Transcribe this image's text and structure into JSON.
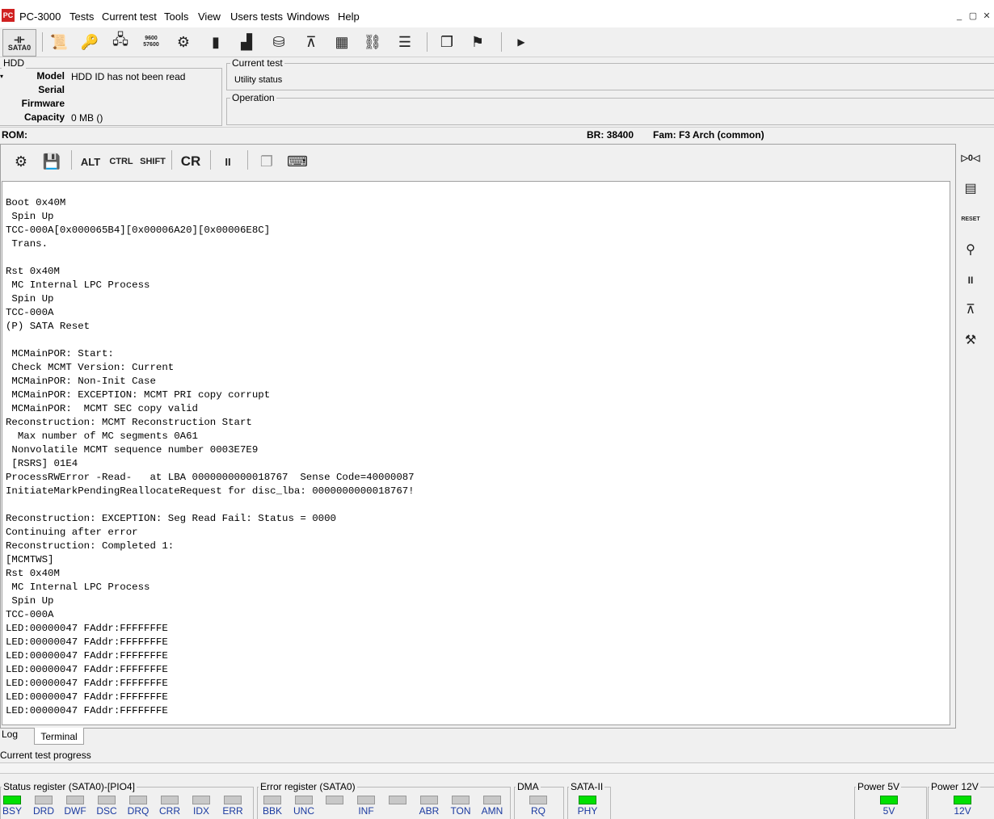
{
  "app": {
    "title": "PC-3000",
    "logo_text": "PC",
    "menu": [
      "Tests",
      "Current test",
      "Tools",
      "View",
      "Users tests",
      "Windows",
      "Help"
    ],
    "window_controls": [
      "_",
      "▢",
      "✕"
    ]
  },
  "toolbar": {
    "port_label": "SATA0",
    "buttons": [
      {
        "name": "scroll-icon",
        "glyph": "📜"
      },
      {
        "name": "key-icon",
        "glyph": "🔑"
      },
      {
        "name": "device-icon",
        "glyph": "🖧"
      },
      {
        "name": "baud-icon",
        "glyph": "9600\n57600"
      },
      {
        "name": "gear-settings-icon",
        "glyph": "⚙"
      },
      {
        "name": "chip-icon",
        "glyph": "▮"
      },
      {
        "name": "hdd-chart-icon",
        "glyph": "▟"
      },
      {
        "name": "disk-icon",
        "glyph": "⛁"
      },
      {
        "name": "heads-icon",
        "glyph": "⊼"
      },
      {
        "name": "grid-icon",
        "glyph": "▦"
      },
      {
        "name": "network-icon",
        "glyph": "⛓"
      },
      {
        "name": "list-icon",
        "glyph": "☰"
      },
      {
        "name": "copy-icon",
        "glyph": "❐"
      },
      {
        "name": "runner-icon",
        "glyph": "⚑"
      },
      {
        "name": "play-icon",
        "glyph": "▶"
      }
    ]
  },
  "hdd": {
    "group_label": "HDD",
    "fields": [
      {
        "label": "Model",
        "value": "HDD ID has not been read"
      },
      {
        "label": "Serial",
        "value": ""
      },
      {
        "label": "Firmware",
        "value": ""
      },
      {
        "label": "Capacity",
        "value": "0 MB ()"
      }
    ]
  },
  "current_test": {
    "group_label": "Current test",
    "status": "Utility status"
  },
  "operation": {
    "group_label": "Operation"
  },
  "rom_bar": {
    "rom": "ROM:",
    "br": "BR: 38400",
    "fam": "Fam: F3 Arch (common)"
  },
  "terminal_toolbar": {
    "alt": "ALT",
    "ctrl": "CTRL",
    "shift": "SHIFT",
    "cr": "CR",
    "pause": "II"
  },
  "terminal": {
    "lines": [
      "Boot 0x40M",
      " Spin Up",
      "TCC-000A[0x000065B4][0x00006A20][0x00006E8C]",
      " Trans.",
      "",
      "Rst 0x40M",
      " MC Internal LPC Process",
      " Spin Up",
      "TCC-000A",
      "(P) SATA Reset",
      "",
      " MCMainPOR: Start:",
      " Check MCMT Version: Current",
      " MCMainPOR: Non-Init Case",
      " MCMainPOR: EXCEPTION: MCMT PRI copy corrupt",
      " MCMainPOR:  MCMT SEC copy valid",
      "Reconstruction: MCMT Reconstruction Start",
      "  Max number of MC segments 0A61",
      " Nonvolatile MCMT sequence number 0003E7E9",
      " [RSRS] 01E4",
      "ProcessRWError -Read-   at LBA 0000000000018767  Sense Code=40000087",
      "InitiateMarkPendingReallocateRequest for disc_lba: 0000000000018767!",
      "",
      "Reconstruction: EXCEPTION: Seg Read Fail: Status = 0000",
      "Continuing after error",
      "Reconstruction: Completed 1:",
      "[MCMTWS]",
      "Rst 0x40M",
      " MC Internal LPC Process",
      " Spin Up",
      "TCC-000A",
      "LED:00000047 FAddr:FFFFFFFE",
      "LED:00000047 FAddr:FFFFFFFE",
      "LED:00000047 FAddr:FFFFFFFE",
      "LED:00000047 FAddr:FFFFFFFE",
      "LED:00000047 FAddr:FFFFFFFE",
      "LED:00000047 FAddr:FFFFFFFE",
      "LED:00000047 FAddr:FFFFFFFE"
    ]
  },
  "side_toolbar": [
    {
      "name": "power-cycle-icon",
      "glyph": "▷0◁"
    },
    {
      "name": "board-icon",
      "glyph": "▤"
    },
    {
      "name": "reset-icon",
      "glyph": "RESET"
    },
    {
      "name": "probe-icon",
      "glyph": "⚲"
    },
    {
      "name": "pause-icon",
      "glyph": "II"
    },
    {
      "name": "heads-play-icon",
      "glyph": "⊼"
    },
    {
      "name": "tools-icon",
      "glyph": "⚒"
    }
  ],
  "tabs": [
    {
      "label": "Log",
      "active": false
    },
    {
      "label": "Terminal",
      "active": true
    }
  ],
  "progress": {
    "label": "Current test progress"
  },
  "status_register": {
    "label": "Status register (SATA0)-[PIO4]",
    "bits": [
      {
        "name": "BSY",
        "on": true
      },
      {
        "name": "DRD",
        "on": false
      },
      {
        "name": "DWF",
        "on": false
      },
      {
        "name": "DSC",
        "on": false
      },
      {
        "name": "DRQ",
        "on": false
      },
      {
        "name": "CRR",
        "on": false
      },
      {
        "name": "IDX",
        "on": false
      },
      {
        "name": "ERR",
        "on": false
      }
    ]
  },
  "error_register": {
    "label": "Error register (SATA0)",
    "bits": [
      {
        "name": "BBK",
        "on": false
      },
      {
        "name": "UNC",
        "on": false
      },
      {
        "name": "",
        "on": false
      },
      {
        "name": "INF",
        "on": false
      },
      {
        "name": "",
        "on": false
      },
      {
        "name": "ABR",
        "on": false
      },
      {
        "name": "TON",
        "on": false
      },
      {
        "name": "AMN",
        "on": false
      }
    ]
  },
  "dma": {
    "label": "DMA",
    "bit": "RQ",
    "on": false
  },
  "sata2": {
    "label": "SATA-II",
    "bit": "PHY",
    "on": true
  },
  "power5": {
    "label": "Power 5V",
    "bit": "5V",
    "on": true
  },
  "power12": {
    "label": "Power 12V",
    "bit": "12V",
    "on": true
  },
  "colors": {
    "indicator_on": "#00e000",
    "indicator_off": "#c8c8c8",
    "label_blue": "#1a3aa0"
  }
}
